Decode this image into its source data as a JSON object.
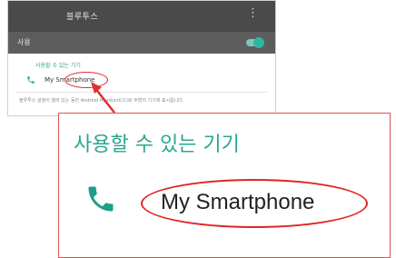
{
  "phone": {
    "title": "블루투스",
    "menu_glyph": "⋮",
    "toggle_label": "사용",
    "toggle_on": true,
    "section_title": "사용할 수 있는 기기",
    "device_name": "My Smartphone",
    "footer_text": "블루투스 설정이 열려 있는 동안 Android Headunit(으)로 주변의 기기에 표시됩니다.",
    "colors": {
      "header_bg": "#4a4a4a",
      "toggle_row_bg": "#5d5d5d",
      "accent": "#2ba58f",
      "highlight": "#e23030"
    }
  },
  "zoom": {
    "section_title": "사용할 수 있는 기기",
    "device_icon": "phone-icon",
    "device_name": "My Smartphone"
  }
}
